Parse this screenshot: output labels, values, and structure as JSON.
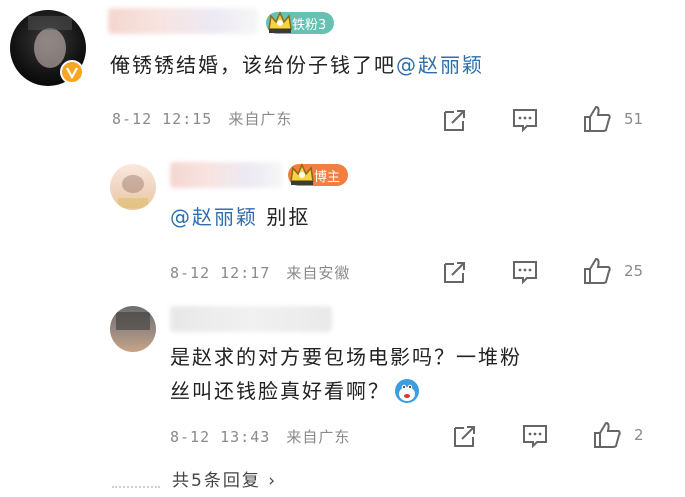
{
  "comments": [
    {
      "badge": "铁粉3",
      "text_main": "俺锈锈结婚，该给份子钱了吧",
      "mention": "@赵丽颖",
      "time": "8-12 12:15",
      "source": "来自广东",
      "likes": "51"
    },
    {
      "badge": "博主",
      "mention": "@赵丽颖",
      "text_main": " 别抠",
      "time": "8-12 12:17",
      "source": "来自安徽",
      "likes": "25"
    },
    {
      "line1": "是赵求的对方要包场电影吗？一堆粉",
      "line2": "丝叫还钱脸真好看啊？",
      "time": "8-12 13:43",
      "source": "来自广东",
      "likes": "2"
    }
  ],
  "replies_link": "共5条回复 ›",
  "icons": [
    "share-icon",
    "comment-icon",
    "like-icon",
    "emoji-icon",
    "crown-icon",
    "verified-icon"
  ],
  "colors": {
    "mention": "#2f6dad",
    "fans_badge": "#67c1b3",
    "blogger_badge": "#f27f40",
    "meta": "#8a8a8a"
  }
}
